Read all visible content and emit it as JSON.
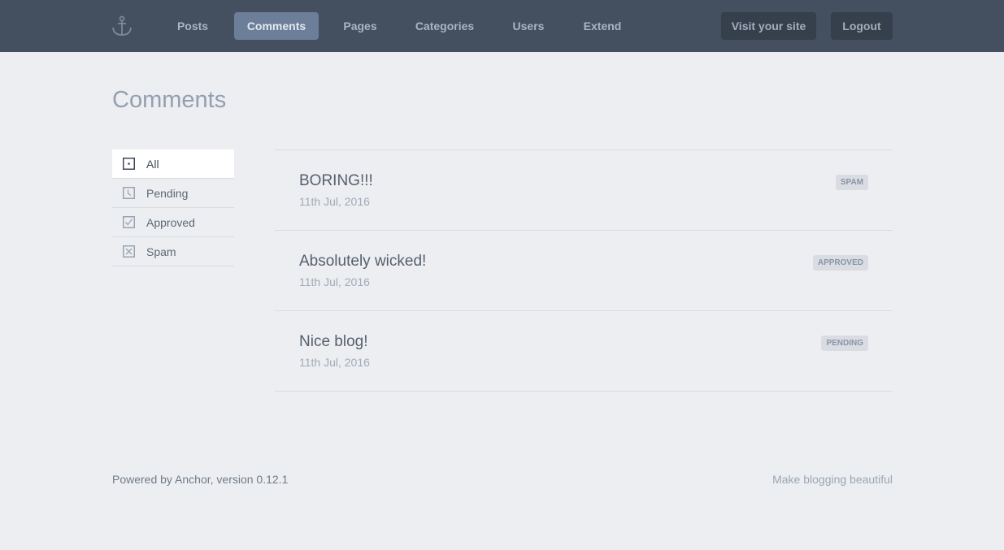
{
  "nav": {
    "items": [
      {
        "label": "Posts"
      },
      {
        "label": "Comments",
        "active": true
      },
      {
        "label": "Pages"
      },
      {
        "label": "Categories"
      },
      {
        "label": "Users"
      },
      {
        "label": "Extend"
      }
    ],
    "visit_site_label": "Visit your site",
    "logout_label": "Logout",
    "logo_icon": "anchor-icon"
  },
  "page": {
    "title": "Comments"
  },
  "filters": [
    {
      "label": "All",
      "icon": "all-icon",
      "active": true
    },
    {
      "label": "Pending",
      "icon": "clock-icon"
    },
    {
      "label": "Approved",
      "icon": "check-icon"
    },
    {
      "label": "Spam",
      "icon": "cross-icon"
    }
  ],
  "comments": [
    {
      "text": "BORING!!!",
      "date": "11th Jul, 2016",
      "status": "SPAM"
    },
    {
      "text": "Absolutely wicked!",
      "date": "11th Jul, 2016",
      "status": "APPROVED"
    },
    {
      "text": "Nice blog!",
      "date": "11th Jul, 2016",
      "status": "PENDING"
    }
  ],
  "footer": {
    "powered_by": "Powered by Anchor, version 0.12.1",
    "tagline": "Make blogging beautiful"
  },
  "colors": {
    "topbar": "#444f5f",
    "nav_active": "#6d7e99",
    "background": "#eceef1"
  }
}
